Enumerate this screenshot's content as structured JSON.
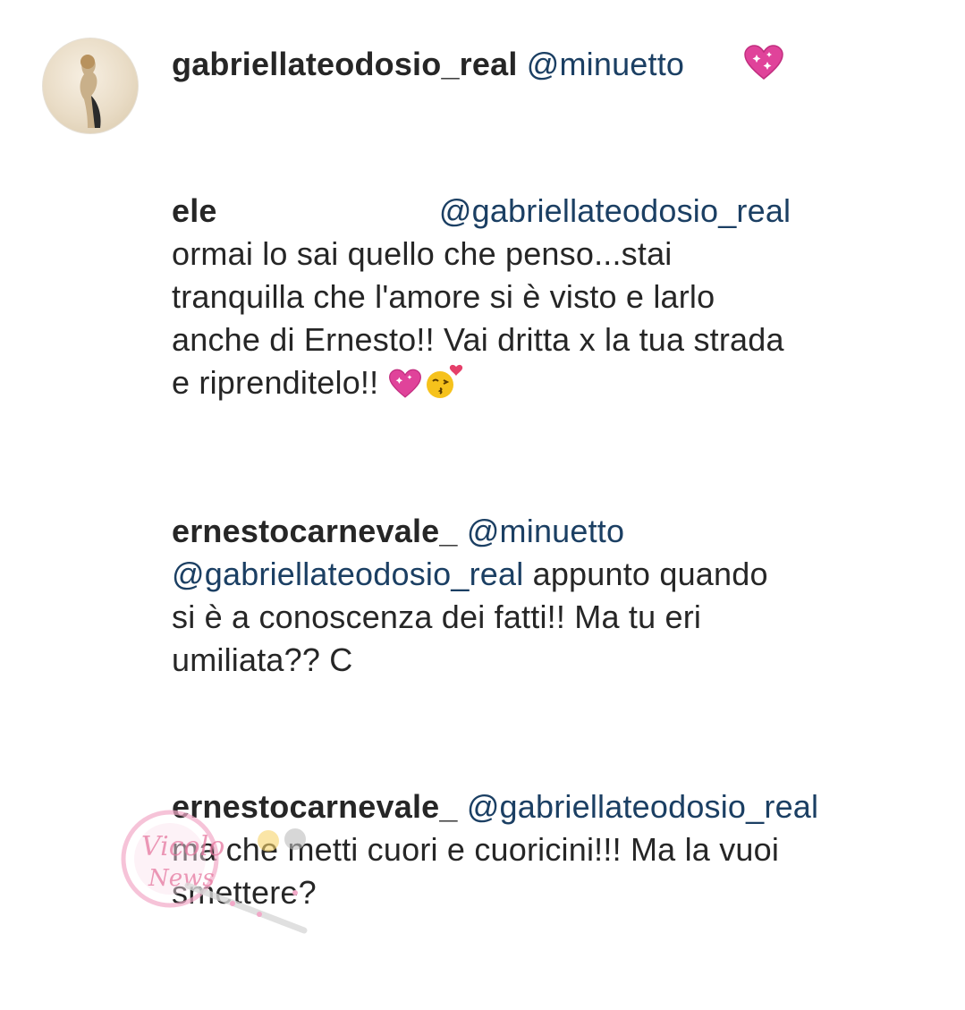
{
  "comments": [
    {
      "username": "gabriellateodosio_real",
      "mention": "@minuetto",
      "lines": [],
      "emoji": [
        "sparkling-heart"
      ]
    },
    {
      "username": "ele",
      "mention": "@gabriellateodosio_real",
      "lines": [
        "ormai lo sai quello che penso...stai",
        "tranquilla che l'amore si è visto e larlo",
        "anche di Ernesto!! Vai dritta x la tua strada",
        "e riprenditelo!!"
      ],
      "emoji": [
        "sparkling-heart",
        "kiss-face"
      ]
    },
    {
      "username": "ernestocarnevale_",
      "mention": "@minuetto",
      "mention2": "@gabriellateodosio_real",
      "line1_rest": "appunto quando",
      "lines": [
        "si è a conoscenza dei fatti!! Ma tu eri",
        "umiliata?? C"
      ]
    },
    {
      "username": "ernestocarnevale_",
      "mention": "@gabriellateodosio_real",
      "lines": [
        "ma che metti cuori e cuoricini!!! Ma la vuoi",
        "smettere?"
      ]
    }
  ],
  "watermark": {
    "text": "Vicolo delle News"
  },
  "colors": {
    "mention": "#1b3f63",
    "text": "#262626",
    "heart": "#e0439a"
  }
}
